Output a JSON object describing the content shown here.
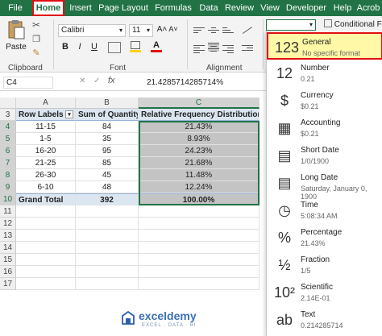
{
  "tabs": [
    "File",
    "Home",
    "Insert",
    "Page Layout",
    "Formulas",
    "Data",
    "Review",
    "View",
    "Developer",
    "Help",
    "Acrob"
  ],
  "ribbon": {
    "paste_label": "Paste",
    "clipboard_label": "Clipboard",
    "font_name": "Calibri",
    "font_size": "11",
    "font_label": "Font",
    "alignment_label": "Alignment",
    "conditional_label": "Conditional For",
    "bold": "B",
    "italic": "I",
    "underline": "U",
    "grow_font": "A˄",
    "shrink_font": "A˅"
  },
  "formula_bar": {
    "name_box": "C4",
    "fx": "fx",
    "formula": "21.4285714285714%"
  },
  "grid": {
    "columns": [
      "A",
      "B",
      "C"
    ],
    "rows": [
      "3",
      "4",
      "5",
      "6",
      "7",
      "8",
      "9",
      "10",
      "11",
      "12",
      "13",
      "14",
      "15",
      "16",
      "17"
    ],
    "header": [
      "Row Labels",
      "Sum of Quantity",
      "Relative Frequency Distribution"
    ],
    "data": [
      [
        "11-15",
        "84",
        "21.43%"
      ],
      [
        "1-5",
        "35",
        "8.93%"
      ],
      [
        "16-20",
        "95",
        "24.23%"
      ],
      [
        "21-25",
        "85",
        "21.68%"
      ],
      [
        "26-30",
        "45",
        "11.48%"
      ],
      [
        "6-10",
        "48",
        "12.24%"
      ]
    ],
    "total": [
      "Grand Total",
      "392",
      "100.00%"
    ]
  },
  "number_format_menu": [
    {
      "title": "General",
      "sub": "No specific format",
      "icon": "clock-123-icon"
    },
    {
      "title": "Number",
      "sub": "0.21",
      "icon": "number-12-icon"
    },
    {
      "title": "Currency",
      "sub": "$0.21",
      "icon": "currency-coins-icon"
    },
    {
      "title": "Accounting",
      "sub": "$0.21",
      "icon": "accounting-calculator-icon"
    },
    {
      "title": "Short Date",
      "sub": "1/0/1900",
      "icon": "calendar-icon"
    },
    {
      "title": "Long Date",
      "sub": "Saturday, January 0, 1900",
      "icon": "calendar-large-icon"
    },
    {
      "title": "Time",
      "sub": "5:08:34 AM",
      "icon": "clock-icon"
    },
    {
      "title": "Percentage",
      "sub": "21.43%",
      "icon": "percent-icon"
    },
    {
      "title": "Fraction",
      "sub": "1/5",
      "icon": "fraction-icon"
    },
    {
      "title": "Scientific",
      "sub": "2.14E-01",
      "icon": "scientific-icon"
    },
    {
      "title": "Text",
      "sub": "0.214285714",
      "icon": "text-ab-icon"
    }
  ],
  "menu_glyphs": [
    "123",
    "12",
    "$",
    "▦",
    "▤",
    "▤",
    "◷",
    "%",
    "½",
    "10²",
    "ab"
  ],
  "watermark": "exceldemy",
  "watermark_sub": "EXCEL · DATA · BI",
  "colors": {
    "excel_green": "#217346",
    "highlight": "#fff8a6",
    "callout_red": "#e01010",
    "pivot_blue": "#dce6f1"
  }
}
